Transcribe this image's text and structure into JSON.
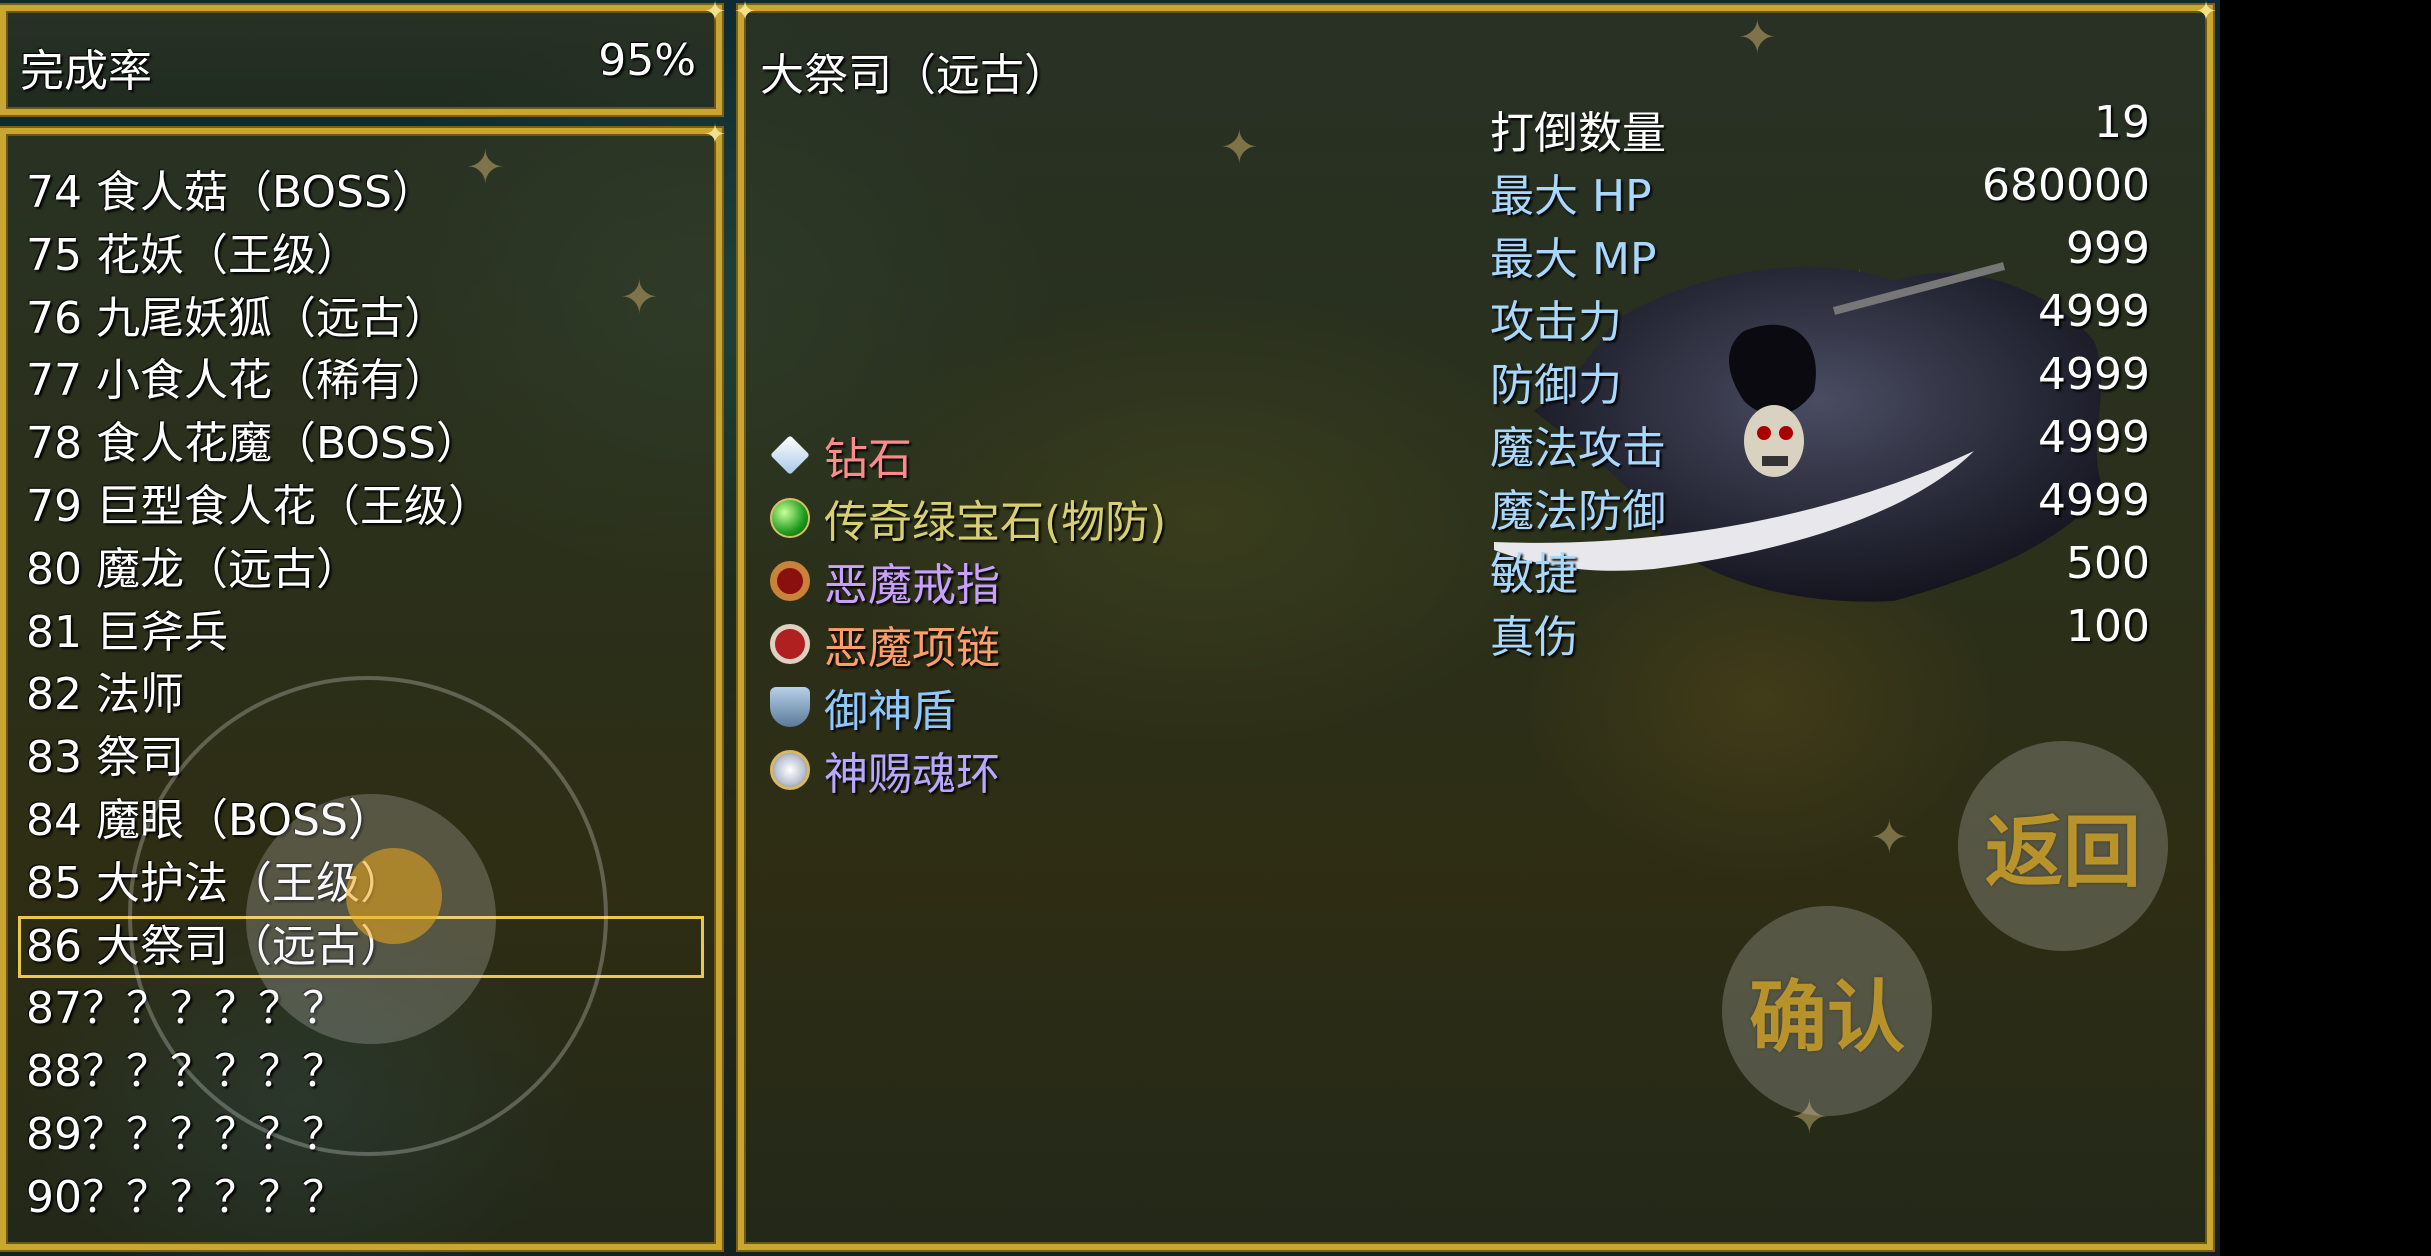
{
  "completion": {
    "label": "完成率",
    "value": "95%"
  },
  "monster_list": [
    "74 食人菇（BOSS）",
    "75 花妖（王级）",
    "76 九尾妖狐（远古）",
    "77 小食人花（稀有）",
    "78 食人花魔（BOSS）",
    "79 巨型食人花（王级）",
    "80 魔龙（远古）",
    "81 巨斧兵",
    "82 法师",
    "83 祭司",
    "84 魔眼（BOSS）",
    "85 大护法（王级）",
    "86 大祭司（远古）",
    "87？？？？？？",
    "88？？？？？？",
    "89？？？？？？",
    "90？？？？？？"
  ],
  "selected_index": 12,
  "detail": {
    "title": "大祭司（远古）",
    "stats": [
      {
        "label": "打倒数量",
        "value": "19"
      },
      {
        "label": "最大 HP",
        "value": "680000"
      },
      {
        "label": "最大 MP",
        "value": "999"
      },
      {
        "label": "攻击力",
        "value": "4999"
      },
      {
        "label": "防御力",
        "value": "4999"
      },
      {
        "label": "魔法攻击",
        "value": "4999"
      },
      {
        "label": "魔法防御",
        "value": "4999"
      },
      {
        "label": "敏捷",
        "value": "500"
      },
      {
        "label": "真伤",
        "value": "100"
      }
    ],
    "drops": [
      {
        "name": "钻石",
        "icon": "diamond-icon",
        "color": "#ff8a8a"
      },
      {
        "name": "传奇绿宝石(物防)",
        "icon": "green-gem-icon",
        "color": "#d8d070"
      },
      {
        "name": "恶魔戒指",
        "icon": "ring-icon",
        "color": "#c9a0ff"
      },
      {
        "name": "恶魔项链",
        "icon": "necklace-icon",
        "color": "#ff9e6b"
      },
      {
        "name": "御神盾",
        "icon": "shield-icon",
        "color": "#8ec8ff"
      },
      {
        "name": "神赐魂环",
        "icon": "halo-ring-icon",
        "color": "#b8a8ff"
      }
    ]
  },
  "buttons": {
    "back": "返回",
    "confirm": "确认"
  },
  "colors": {
    "frame_gold": "#c9a532",
    "stat_label": "#a9d8ff"
  }
}
